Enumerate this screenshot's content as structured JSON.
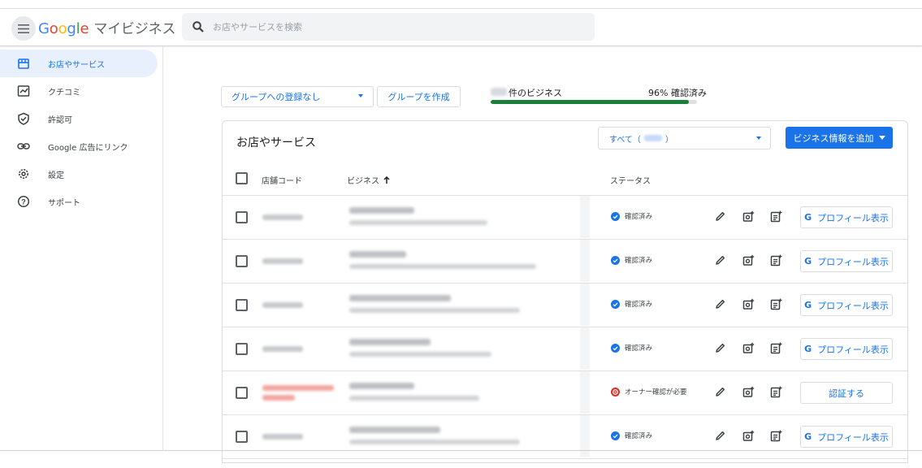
{
  "app": {
    "logo_google": [
      "G",
      "o",
      "o",
      "g",
      "l",
      "e"
    ],
    "product_name": "マイビジネス"
  },
  "search": {
    "placeholder": "お店やサービスを検索"
  },
  "sidebar": {
    "items": [
      {
        "label": "お店やサービス",
        "icon": "storefront-icon",
        "active": true
      },
      {
        "label": "クチコミ",
        "icon": "reviews-icon",
        "active": false
      },
      {
        "label": "許認可",
        "icon": "verified-shield-icon",
        "active": false
      },
      {
        "label": "Google 広告にリンク",
        "icon": "link-icon",
        "active": false
      },
      {
        "label": "設定",
        "icon": "settings-gear-icon",
        "active": false
      },
      {
        "label": "サポート",
        "icon": "help-circle-icon",
        "active": false
      }
    ]
  },
  "toolbar": {
    "group_select": "グループへの登録なし",
    "create_group": "グループを作成",
    "count_suffix": "件のビジネス",
    "verified_percent_label": "96% 確認済み",
    "verified_fraction": 0.96
  },
  "card": {
    "title": "お店やサービス",
    "filter_prefix": "すべて（",
    "filter_suffix": "）",
    "add_business": "ビジネス情報を追加",
    "columns": {
      "code": "店舗コード",
      "business": "ビジネス",
      "status": "ステータス"
    }
  },
  "rows": [
    {
      "status": "確認済み",
      "status_type": "verified",
      "action": "プロフィール表示"
    },
    {
      "status": "確認済み",
      "status_type": "verified",
      "action": "プロフィール表示"
    },
    {
      "status": "確認済み",
      "status_type": "verified",
      "action": "プロフィール表示"
    },
    {
      "status": "確認済み",
      "status_type": "verified",
      "action": "プロフィール表示"
    },
    {
      "status": "オーナー確認が必要",
      "status_type": "needs_verification",
      "action": "認証する"
    },
    {
      "status": "確認済み",
      "status_type": "verified",
      "action": "プロフィール表示"
    }
  ],
  "colors": {
    "accent": "#1a73e8",
    "progress": "#188038",
    "active_bg": "#e8f0fe",
    "alert": "#d93025"
  }
}
